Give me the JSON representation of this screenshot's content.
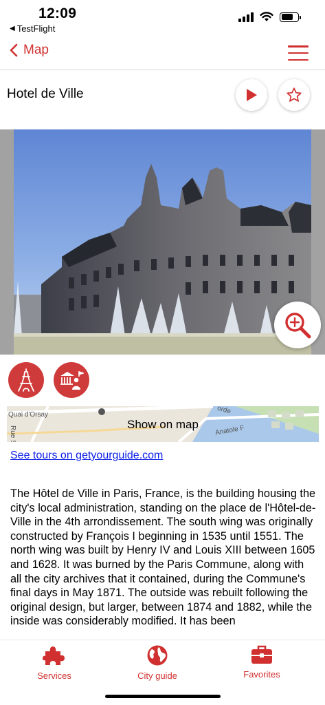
{
  "status_bar": {
    "time": "12:09",
    "back_app": "TestFlight"
  },
  "nav": {
    "back_label": "Map",
    "accent_color": "#d0302f",
    "menu_icon": "hamburger-icon"
  },
  "place": {
    "title": "Hotel de Ville",
    "play_icon": "play-icon",
    "favorite_icon": "star-icon"
  },
  "photo": {
    "zoom_icon": "zoom-in-icon"
  },
  "categories": [
    {
      "icon": "eiffel-tower-icon"
    },
    {
      "icon": "guide-museum-icon"
    }
  ],
  "map_preview": {
    "label": "Show on map",
    "street_labels": [
      "Quai d'Orsay",
      "Rue S",
      "Anatole F",
      "orde"
    ]
  },
  "tours_link": "See tours on getyourguide.com",
  "description": "The Hôtel de Ville in Paris, France, is the building housing the city's local administration, standing on the place de l'Hôtel-de-Ville in the 4th arrondissement. The south wing was originally constructed by François I beginning in 1535 until 1551. The north wing was built by Henry IV and Louis XIII between 1605 and 1628. It was burned by the Paris Commune, along with all the city archives that it contained, during the Commune's final days in May 1871. The outside was rebuilt following the original design, but larger, between 1874 and 1882, while the inside was considerably modified. It has been",
  "tabs": [
    {
      "label": "Services",
      "icon": "puzzle-icon"
    },
    {
      "label": "City guide",
      "icon": "globe-icon"
    },
    {
      "label": "Favorites",
      "icon": "briefcase-icon"
    }
  ]
}
